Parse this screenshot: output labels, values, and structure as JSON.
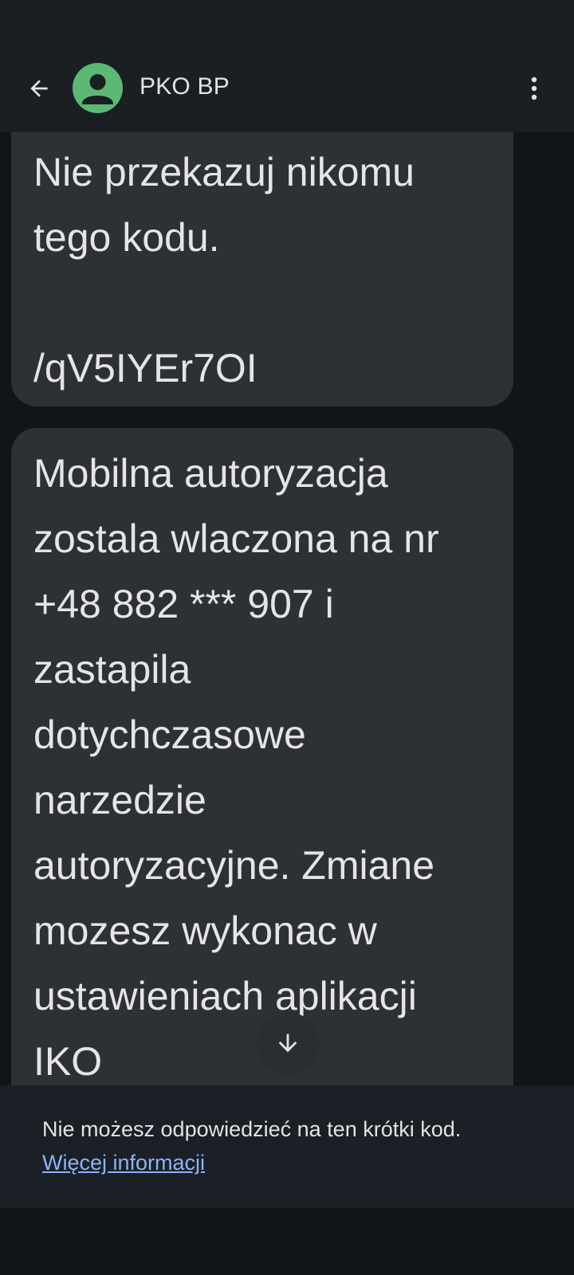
{
  "app_bar": {
    "contact_name": "PKO BP",
    "back_icon": "arrow-left-icon",
    "avatar_icon": "person-icon",
    "menu_icon": "more-vert-icon"
  },
  "messages": [
    {
      "text": "Nie przekazuj nikomu\ntego kodu.\n\n/qV5IYEr7OI"
    },
    {
      "text": "Mobilna autoryzacja\nzostala wlaczona na nr\n+48 882 *** 907 i\nzastapila\ndotychczasowe\nnarzedzie\nautoryzacyjne. Zmiane\nmozesz wykonac w\nustawieniach aplikacji\nIKO"
    }
  ],
  "scroll_button": {
    "icon": "arrow-down-icon"
  },
  "notice": {
    "text": "Nie możesz odpowiedzieć na ten krótki kod.",
    "link": "Więcej informacji"
  },
  "colors": {
    "avatar": "#5bb974",
    "bubble": "#2d3035",
    "link": "#8ab4f8",
    "background": "#111419"
  }
}
